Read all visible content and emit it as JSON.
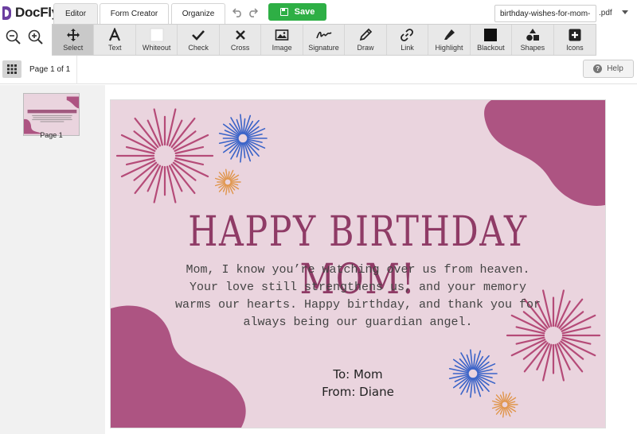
{
  "app": {
    "logo": "DocFly"
  },
  "tabs": [
    {
      "label": "Editor"
    },
    {
      "label": "Form Creator"
    },
    {
      "label": "Organize"
    }
  ],
  "save": {
    "label": "Save"
  },
  "file": {
    "name": "birthday-wishes-for-mom-",
    "extension": ".pdf"
  },
  "tools": [
    {
      "label": "Select",
      "icon": "move-arrows-icon"
    },
    {
      "label": "Text",
      "icon": "text-a-icon"
    },
    {
      "label": "Whiteout",
      "icon": "white-square-icon"
    },
    {
      "label": "Check",
      "icon": "checkmark-icon"
    },
    {
      "label": "Cross",
      "icon": "cross-x-icon"
    },
    {
      "label": "Image",
      "icon": "image-icon"
    },
    {
      "label": "Signature",
      "icon": "signature-icon"
    },
    {
      "label": "Draw",
      "icon": "pencil-icon"
    },
    {
      "label": "Link",
      "icon": "chain-link-icon"
    },
    {
      "label": "Highlight",
      "icon": "highlighter-icon"
    },
    {
      "label": "Blackout",
      "icon": "black-square-icon"
    },
    {
      "label": "Shapes",
      "icon": "shapes-icon"
    },
    {
      "label": "Icons",
      "icon": "plus-box-icon"
    }
  ],
  "pager": {
    "text": "Page 1 of 1"
  },
  "help": {
    "label": "Help"
  },
  "thumbnail": {
    "label": "Page 1"
  },
  "card": {
    "title": "HAPPY BIRTHDAY MOM!",
    "message": "Mom, I know you’re watching over us from heaven.\nYour love still  strengthens us, and your memory\nwarms our hearts. Happy  birthday, and thank you for\nalways being our guardian angel.",
    "to": "To: Mom",
    "from": "From: Diane"
  },
  "colors": {
    "card_bg": "#ead4de",
    "blob": "#ad5482",
    "title": "#8f3b66",
    "save_green": "#2eaf45",
    "firework_red": "#b54b78",
    "firework_blue": "#3a63c8",
    "firework_orange": "#e0954a"
  }
}
